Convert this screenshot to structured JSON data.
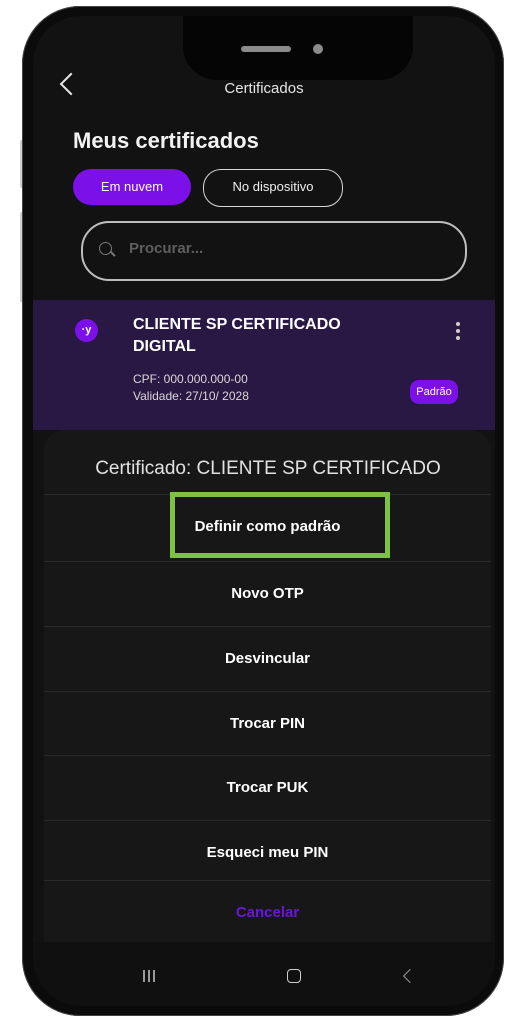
{
  "header": {
    "title": "Certificados"
  },
  "page": {
    "title": "Meus certificados"
  },
  "filters": {
    "cloud": "Em nuvem",
    "device": "No dispositivo"
  },
  "search": {
    "placeholder": "Procurar..."
  },
  "certificate": {
    "avatar": "·y",
    "name": "CLIENTE SP CERTIFICADO DIGITAL",
    "cpf": "CPF: 000.000.000-00",
    "validity": "Validade: 27/10/ 2028",
    "badge": "Padrão"
  },
  "sheet": {
    "title": "Certificado:  CLIENTE SP CERTIFICADO",
    "options": [
      "Definir como padrão",
      "Novo OTP",
      "Desvincular",
      "Trocar PIN",
      "Trocar PUK",
      "Esqueci meu PIN"
    ],
    "cancel": "Cancelar"
  },
  "colors": {
    "accent": "#7b10e8",
    "highlight": "#7dc242",
    "background": "#121212"
  },
  "icons": [
    "back-arrow-icon",
    "search-icon",
    "more-vertical-icon",
    "recent-apps-icon",
    "home-icon",
    "nav-back-icon"
  ]
}
